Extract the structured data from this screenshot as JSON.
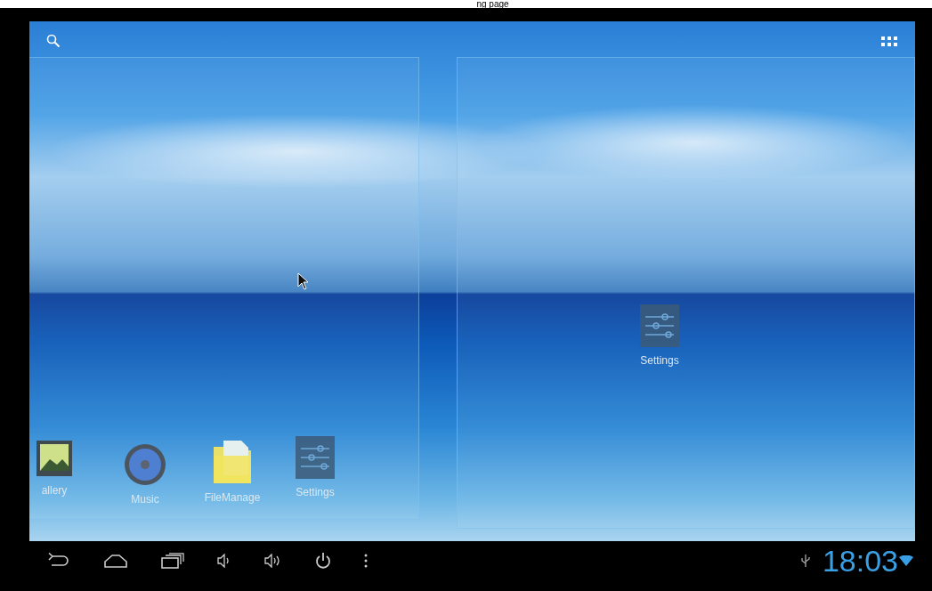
{
  "top_caption": "ng page",
  "dock_apps": [
    {
      "kind": "gallery",
      "label": "allery"
    },
    {
      "kind": "music",
      "label": "Music"
    },
    {
      "kind": "folder",
      "label": "FileManage"
    },
    {
      "kind": "settings",
      "label": "Settings"
    }
  ],
  "desktop_apps": [
    {
      "kind": "settings",
      "label": "Settings"
    }
  ],
  "status": {
    "clock": "18:03"
  }
}
